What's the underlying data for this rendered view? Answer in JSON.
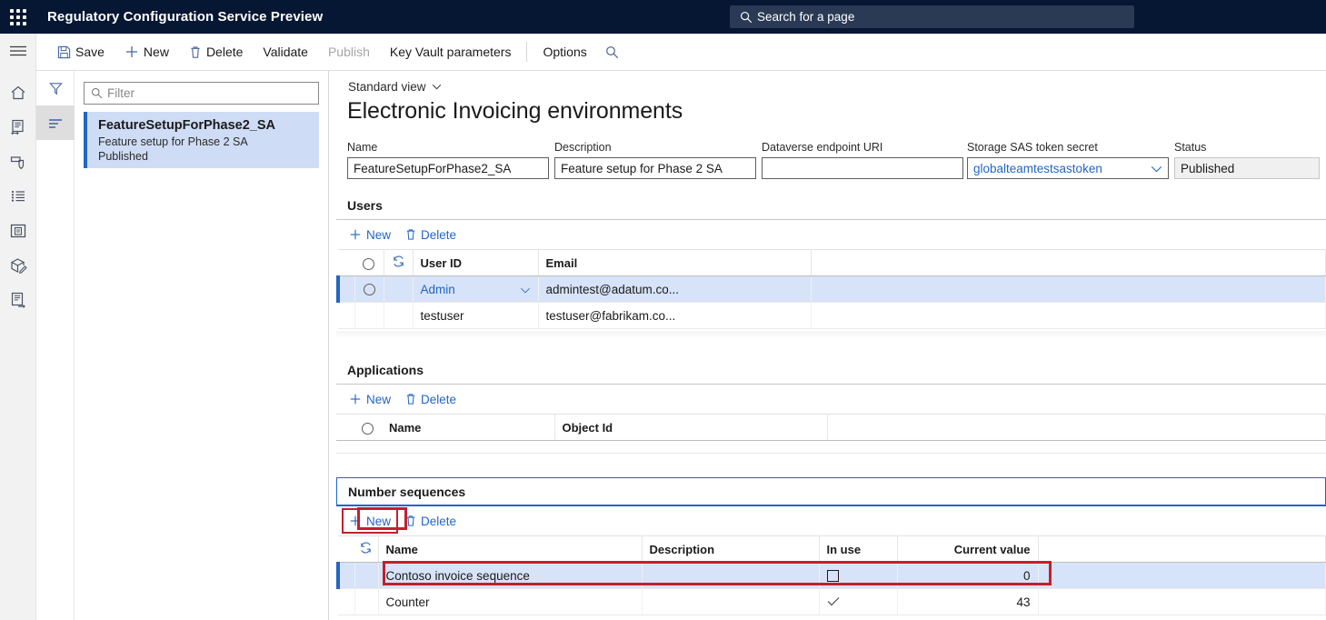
{
  "topbar": {
    "waffle_icon": "waffle-grid-icon",
    "app_title": "Regulatory Configuration Service Preview",
    "search": {
      "icon": "search-icon",
      "placeholder": "Search for a page"
    },
    "background": "#061733",
    "search_background": "#2a3a55"
  },
  "rail": {
    "items": [
      {
        "icon": "hamburger-menu-icon",
        "name": "navigation-menu"
      },
      {
        "icon": "home-icon",
        "name": "home"
      },
      {
        "icon": "document-exchange-icon",
        "name": "configuration-providers"
      },
      {
        "icon": "shield-tag-icon",
        "name": "security"
      },
      {
        "icon": "checklist-icon",
        "name": "task-list"
      },
      {
        "icon": "report-box-icon",
        "name": "reports"
      },
      {
        "icon": "package-edit-icon",
        "name": "packages"
      },
      {
        "icon": "document-export-icon",
        "name": "export"
      }
    ]
  },
  "command_bar": {
    "items": [
      {
        "label": "Save",
        "icon": "save-icon",
        "disabled": false
      },
      {
        "label": "New",
        "icon": "plus-icon",
        "disabled": false
      },
      {
        "label": "Delete",
        "icon": "trash-icon",
        "disabled": false
      },
      {
        "label": "Validate",
        "icon": "",
        "disabled": false
      },
      {
        "label": "Publish",
        "icon": "",
        "disabled": true
      },
      {
        "label": "Key Vault parameters",
        "icon": "",
        "disabled": false
      },
      {
        "label": "Options",
        "icon": "",
        "disabled": false
      }
    ],
    "search_icon": "search-icon"
  },
  "list_pane": {
    "rail": [
      {
        "icon": "filter-funnel-icon",
        "name": "filter-pane-toggle",
        "selected": false
      },
      {
        "icon": "list-lines-icon",
        "name": "list-view-toggle",
        "selected": true
      }
    ],
    "filter": {
      "icon": "search-icon",
      "placeholder": "Filter",
      "value": ""
    },
    "items": [
      {
        "title": "FeatureSetupForPhase2_SA",
        "subtitle": "Feature setup for Phase 2 SA",
        "status": "Published",
        "selected": true
      }
    ]
  },
  "main": {
    "view_selector": {
      "label": "Standard view",
      "icon": "chevron-down-icon"
    },
    "page_title": "Electronic Invoicing environments",
    "fields": [
      {
        "label": "Name",
        "value": "FeatureSetupForPhase2_SA",
        "type": "text"
      },
      {
        "label": "Description",
        "value": "Feature setup for Phase 2 SA",
        "type": "text"
      },
      {
        "label": "Dataverse endpoint URI",
        "value": "",
        "type": "text"
      },
      {
        "label": "Storage SAS token secret",
        "value": "globalteamtestsastoken",
        "type": "lookup",
        "icon": "chevron-down-icon"
      },
      {
        "label": "Status",
        "value": "Published",
        "type": "readonly"
      }
    ],
    "sections": [
      {
        "title": "Users",
        "focused": false,
        "toolbar": [
          {
            "label": "New",
            "icon": "plus-icon",
            "highlighted": false
          },
          {
            "label": "Delete",
            "icon": "trash-icon",
            "highlighted": false
          }
        ],
        "columns": [
          "",
          "",
          "User ID",
          "Email"
        ],
        "header_icons": {
          "select_all": "radio-circle-icon",
          "refresh": "refresh-icon"
        },
        "rows": [
          {
            "user_id": "Admin",
            "email": "admintest@adatum.co...",
            "selected": true,
            "dropdown_icon": "chevron-down-icon"
          },
          {
            "user_id": "testuser",
            "email": "testuser@fabrikam.co...",
            "selected": false
          }
        ]
      },
      {
        "title": "Applications",
        "focused": false,
        "toolbar": [
          {
            "label": "New",
            "icon": "plus-icon",
            "highlighted": false
          },
          {
            "label": "Delete",
            "icon": "trash-icon",
            "highlighted": false
          }
        ],
        "columns": [
          "",
          "Name",
          "Object Id"
        ],
        "header_icons": {
          "select_all": "radio-circle-icon"
        },
        "rows": []
      },
      {
        "title": "Number sequences",
        "focused": true,
        "toolbar": [
          {
            "label": "New",
            "icon": "plus-icon",
            "highlighted": true
          },
          {
            "label": "Delete",
            "icon": "trash-icon",
            "highlighted": false
          }
        ],
        "columns": [
          "",
          "Name",
          "Description",
          "In use",
          "Current value"
        ],
        "header_icons": {
          "refresh": "refresh-icon"
        },
        "rows": [
          {
            "name": "Contoso invoice sequence",
            "description": "",
            "in_use": false,
            "in_use_icon": "checkbox-empty-icon",
            "current_value": "0",
            "selected": true,
            "highlighted": true
          },
          {
            "name": "Counter",
            "description": "",
            "in_use": true,
            "in_use_icon": "checkmark-icon",
            "current_value": "43",
            "selected": false,
            "highlighted": false
          }
        ]
      }
    ]
  },
  "annotations": {
    "color": "#c41f2d",
    "boxes": [
      {
        "name": "new-number-sequence-button-highlight"
      },
      {
        "name": "contoso-invoice-sequence-row-highlight"
      }
    ]
  }
}
